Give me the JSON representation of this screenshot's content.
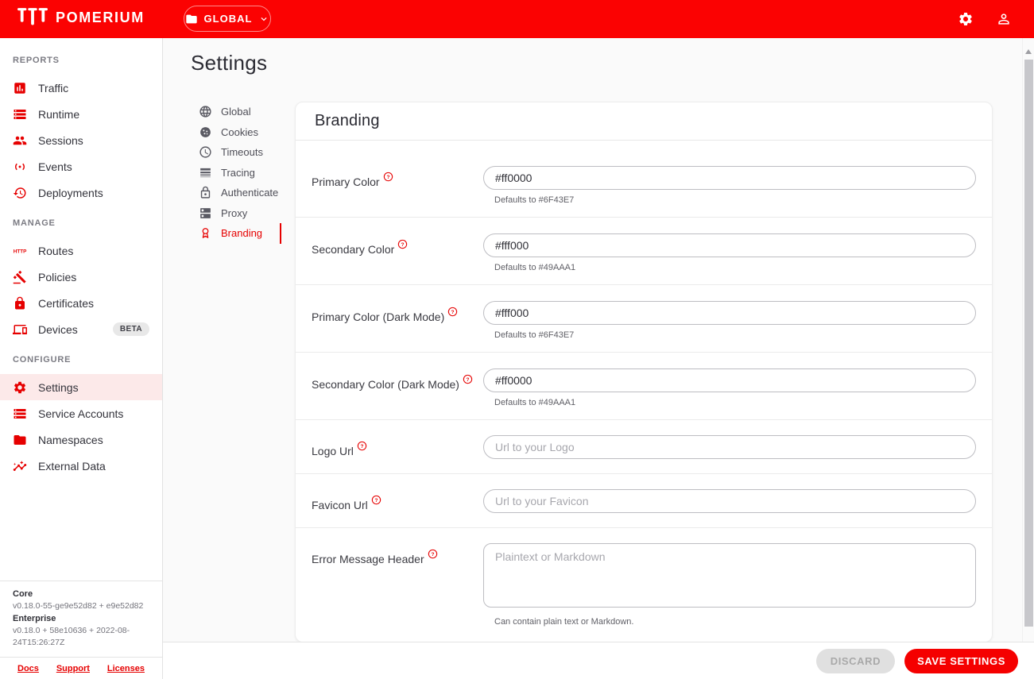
{
  "header": {
    "logo_text": "POMERIUM",
    "namespace_selector": {
      "label": "GLOBAL"
    }
  },
  "sidebar": {
    "sections": [
      {
        "label": "REPORTS",
        "items": [
          {
            "id": "traffic",
            "label": "Traffic",
            "icon": "chart"
          },
          {
            "id": "runtime",
            "label": "Runtime",
            "icon": "storage"
          },
          {
            "id": "sessions",
            "label": "Sessions",
            "icon": "group"
          },
          {
            "id": "events",
            "label": "Events",
            "icon": "sensors"
          },
          {
            "id": "deployments",
            "label": "Deployments",
            "icon": "history"
          }
        ]
      },
      {
        "label": "MANAGE",
        "items": [
          {
            "id": "routes",
            "label": "Routes",
            "icon": "http"
          },
          {
            "id": "policies",
            "label": "Policies",
            "icon": "gavel"
          },
          {
            "id": "certificates",
            "label": "Certificates",
            "icon": "lock"
          },
          {
            "id": "devices",
            "label": "Devices",
            "icon": "devices",
            "badge": "BETA"
          }
        ]
      },
      {
        "label": "CONFIGURE",
        "items": [
          {
            "id": "settings",
            "label": "Settings",
            "icon": "gear",
            "active": true
          },
          {
            "id": "service-accounts",
            "label": "Service Accounts",
            "icon": "storage"
          },
          {
            "id": "namespaces",
            "label": "Namespaces",
            "icon": "folder"
          },
          {
            "id": "external-data",
            "label": "External Data",
            "icon": "insights"
          }
        ]
      }
    ],
    "version": {
      "core_label": "Core",
      "core_version": "v0.18.0-55-ge9e52d82 + e9e52d82",
      "enterprise_label": "Enterprise",
      "enterprise_version": "v0.18.0 + 58e10636 + 2022-08-24T15:26:27Z"
    },
    "links": [
      "Docs",
      "Support",
      "Licenses"
    ]
  },
  "main": {
    "page_title": "Settings",
    "subnav": {
      "items": [
        {
          "id": "global",
          "label": "Global",
          "icon": "globe"
        },
        {
          "id": "cookies",
          "label": "Cookies",
          "icon": "cookie"
        },
        {
          "id": "timeouts",
          "label": "Timeouts",
          "icon": "clock"
        },
        {
          "id": "tracing",
          "label": "Tracing",
          "icon": "line-weight"
        },
        {
          "id": "authenticate",
          "label": "Authenticate",
          "icon": "lock-outline"
        },
        {
          "id": "proxy",
          "label": "Proxy",
          "icon": "dns"
        },
        {
          "id": "branding",
          "label": "Branding",
          "icon": "award",
          "active": true
        }
      ]
    },
    "card": {
      "title": "Branding",
      "fields": [
        {
          "id": "primary-color",
          "label": "Primary Color",
          "type": "text",
          "value": "#ff0000",
          "helper": "Defaults to #6F43E7"
        },
        {
          "id": "secondary-color",
          "label": "Secondary Color",
          "type": "text",
          "value": "#fff000",
          "helper": "Defaults to #49AAA1"
        },
        {
          "id": "primary-color-dark-mode",
          "label": "Primary Color (Dark Mode)",
          "type": "text",
          "value": "#fff000",
          "helper": "Defaults to #6F43E7"
        },
        {
          "id": "secondary-color-dark-mode",
          "label": "Secondary Color (Dark Mode)",
          "type": "text",
          "value": "#ff0000",
          "helper": "Defaults to #49AAA1"
        },
        {
          "id": "logo-url",
          "label": "Logo Url",
          "type": "text",
          "placeholder": "Url to your Logo"
        },
        {
          "id": "favicon-url",
          "label": "Favicon Url",
          "type": "text",
          "placeholder": "Url to your Favicon"
        },
        {
          "id": "error-message-header",
          "label": "Error Message Header",
          "type": "textarea",
          "placeholder": "Plaintext or Markdown",
          "helper": "Can contain plain text or Markdown."
        }
      ]
    }
  },
  "footer": {
    "discard_label": "DISCARD",
    "save_label": "SAVE SETTINGS"
  },
  "colors": {
    "brand_red": "#FB0202",
    "icon_red": "#E60000",
    "active_item_bg": "#FCE9E9",
    "button_red": "#F50000"
  }
}
